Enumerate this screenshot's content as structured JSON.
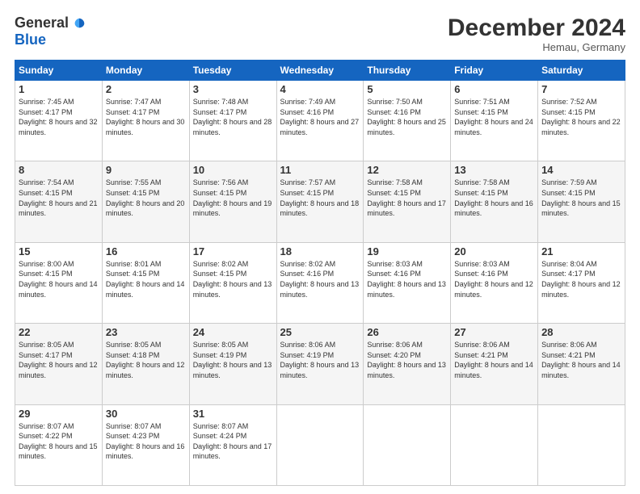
{
  "logo": {
    "general": "General",
    "blue": "Blue"
  },
  "title": "December 2024",
  "location": "Hemau, Germany",
  "days_of_week": [
    "Sunday",
    "Monday",
    "Tuesday",
    "Wednesday",
    "Thursday",
    "Friday",
    "Saturday"
  ],
  "weeks": [
    [
      {
        "day": "1",
        "sunrise": "7:45 AM",
        "sunset": "4:17 PM",
        "daylight": "8 hours and 32 minutes."
      },
      {
        "day": "2",
        "sunrise": "7:47 AM",
        "sunset": "4:17 PM",
        "daylight": "8 hours and 30 minutes."
      },
      {
        "day": "3",
        "sunrise": "7:48 AM",
        "sunset": "4:17 PM",
        "daylight": "8 hours and 28 minutes."
      },
      {
        "day": "4",
        "sunrise": "7:49 AM",
        "sunset": "4:16 PM",
        "daylight": "8 hours and 27 minutes."
      },
      {
        "day": "5",
        "sunrise": "7:50 AM",
        "sunset": "4:16 PM",
        "daylight": "8 hours and 25 minutes."
      },
      {
        "day": "6",
        "sunrise": "7:51 AM",
        "sunset": "4:15 PM",
        "daylight": "8 hours and 24 minutes."
      },
      {
        "day": "7",
        "sunrise": "7:52 AM",
        "sunset": "4:15 PM",
        "daylight": "8 hours and 22 minutes."
      }
    ],
    [
      {
        "day": "8",
        "sunrise": "7:54 AM",
        "sunset": "4:15 PM",
        "daylight": "8 hours and 21 minutes."
      },
      {
        "day": "9",
        "sunrise": "7:55 AM",
        "sunset": "4:15 PM",
        "daylight": "8 hours and 20 minutes."
      },
      {
        "day": "10",
        "sunrise": "7:56 AM",
        "sunset": "4:15 PM",
        "daylight": "8 hours and 19 minutes."
      },
      {
        "day": "11",
        "sunrise": "7:57 AM",
        "sunset": "4:15 PM",
        "daylight": "8 hours and 18 minutes."
      },
      {
        "day": "12",
        "sunrise": "7:58 AM",
        "sunset": "4:15 PM",
        "daylight": "8 hours and 17 minutes."
      },
      {
        "day": "13",
        "sunrise": "7:58 AM",
        "sunset": "4:15 PM",
        "daylight": "8 hours and 16 minutes."
      },
      {
        "day": "14",
        "sunrise": "7:59 AM",
        "sunset": "4:15 PM",
        "daylight": "8 hours and 15 minutes."
      }
    ],
    [
      {
        "day": "15",
        "sunrise": "8:00 AM",
        "sunset": "4:15 PM",
        "daylight": "8 hours and 14 minutes."
      },
      {
        "day": "16",
        "sunrise": "8:01 AM",
        "sunset": "4:15 PM",
        "daylight": "8 hours and 14 minutes."
      },
      {
        "day": "17",
        "sunrise": "8:02 AM",
        "sunset": "4:15 PM",
        "daylight": "8 hours and 13 minutes."
      },
      {
        "day": "18",
        "sunrise": "8:02 AM",
        "sunset": "4:16 PM",
        "daylight": "8 hours and 13 minutes."
      },
      {
        "day": "19",
        "sunrise": "8:03 AM",
        "sunset": "4:16 PM",
        "daylight": "8 hours and 13 minutes."
      },
      {
        "day": "20",
        "sunrise": "8:03 AM",
        "sunset": "4:16 PM",
        "daylight": "8 hours and 12 minutes."
      },
      {
        "day": "21",
        "sunrise": "8:04 AM",
        "sunset": "4:17 PM",
        "daylight": "8 hours and 12 minutes."
      }
    ],
    [
      {
        "day": "22",
        "sunrise": "8:05 AM",
        "sunset": "4:17 PM",
        "daylight": "8 hours and 12 minutes."
      },
      {
        "day": "23",
        "sunrise": "8:05 AM",
        "sunset": "4:18 PM",
        "daylight": "8 hours and 12 minutes."
      },
      {
        "day": "24",
        "sunrise": "8:05 AM",
        "sunset": "4:19 PM",
        "daylight": "8 hours and 13 minutes."
      },
      {
        "day": "25",
        "sunrise": "8:06 AM",
        "sunset": "4:19 PM",
        "daylight": "8 hours and 13 minutes."
      },
      {
        "day": "26",
        "sunrise": "8:06 AM",
        "sunset": "4:20 PM",
        "daylight": "8 hours and 13 minutes."
      },
      {
        "day": "27",
        "sunrise": "8:06 AM",
        "sunset": "4:21 PM",
        "daylight": "8 hours and 14 minutes."
      },
      {
        "day": "28",
        "sunrise": "8:06 AM",
        "sunset": "4:21 PM",
        "daylight": "8 hours and 14 minutes."
      }
    ],
    [
      {
        "day": "29",
        "sunrise": "8:07 AM",
        "sunset": "4:22 PM",
        "daylight": "8 hours and 15 minutes."
      },
      {
        "day": "30",
        "sunrise": "8:07 AM",
        "sunset": "4:23 PM",
        "daylight": "8 hours and 16 minutes."
      },
      {
        "day": "31",
        "sunrise": "8:07 AM",
        "sunset": "4:24 PM",
        "daylight": "8 hours and 17 minutes."
      },
      null,
      null,
      null,
      null
    ]
  ],
  "labels": {
    "sunrise": "Sunrise:",
    "sunset": "Sunset:",
    "daylight": "Daylight:"
  }
}
